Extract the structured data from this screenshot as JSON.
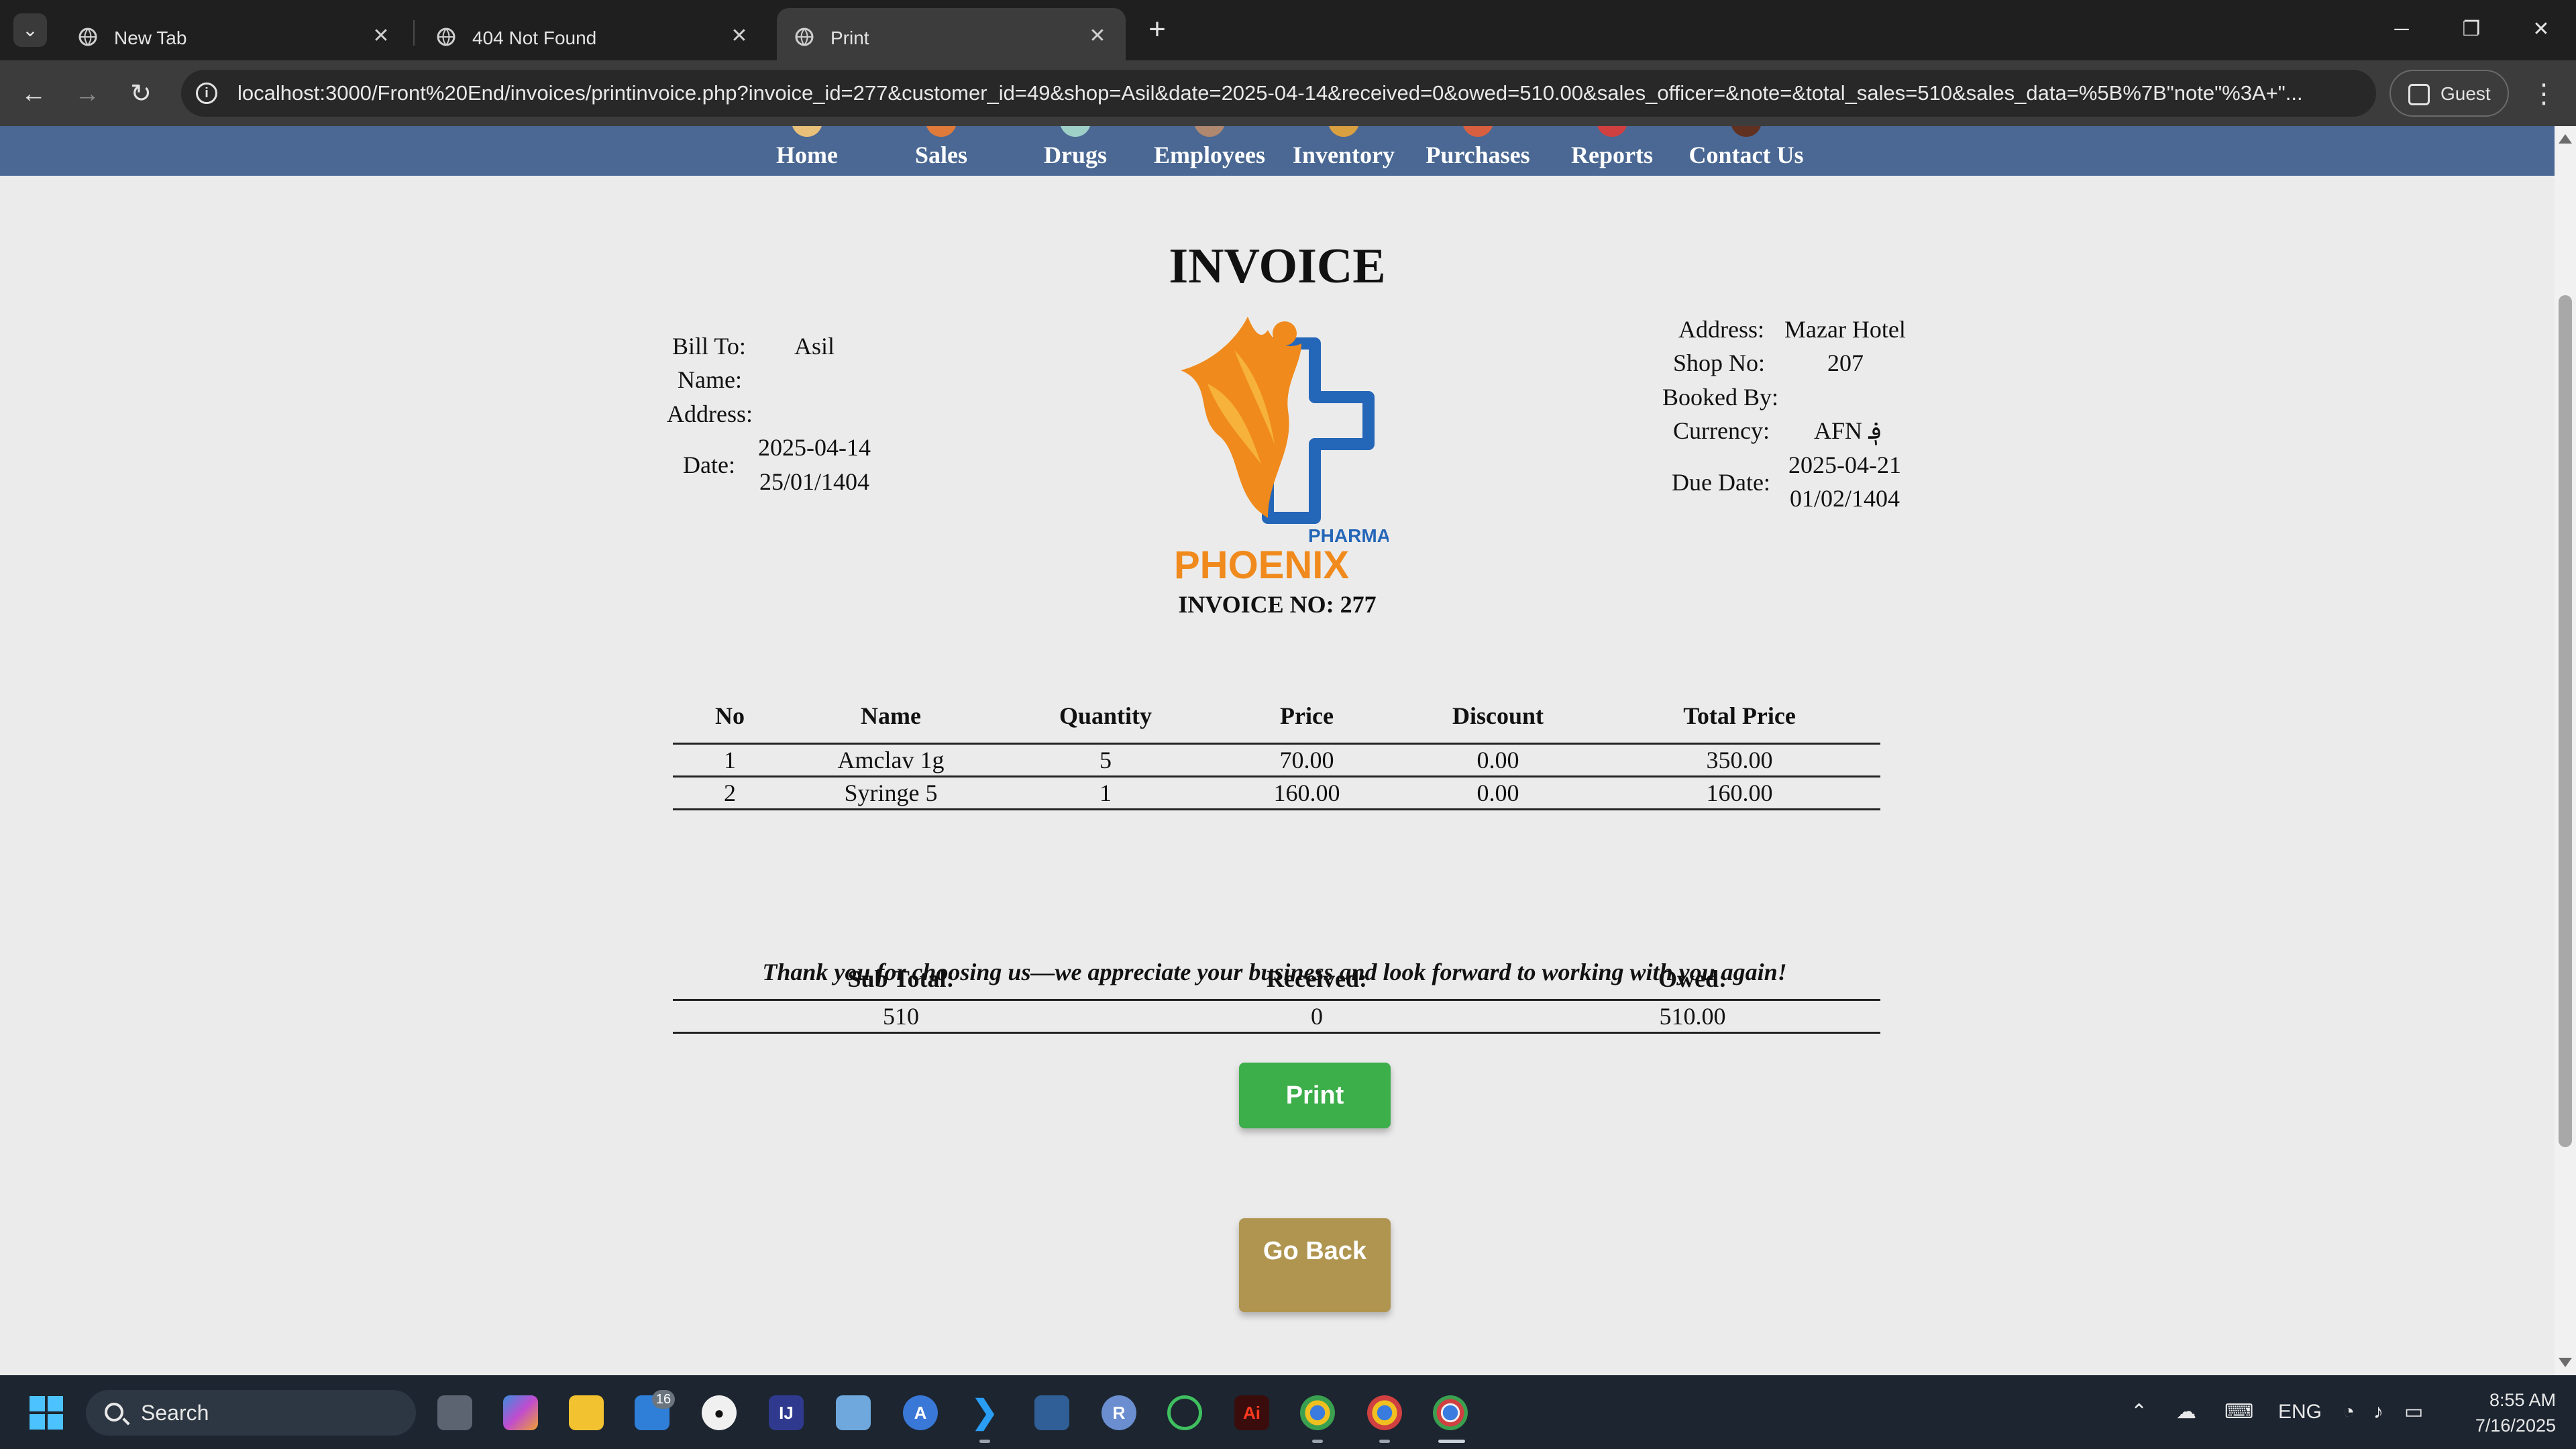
{
  "browser": {
    "tabs": [
      {
        "title": "New Tab",
        "active": false
      },
      {
        "title": "404 Not Found",
        "active": false
      },
      {
        "title": "Print",
        "active": true
      }
    ],
    "url": "localhost:3000/Front%20End/invoices/printinvoice.php?invoice_id=277&customer_id=49&shop=Asil&date=2025-04-14&received=0&owed=510.00&sales_officer=&note=&total_sales=510&sales_data=%5B%7B\"note\"%3A+\"...",
    "profile_label": "Guest"
  },
  "site_nav": {
    "items": [
      {
        "label": "Home",
        "icon": "home-icon",
        "color": "#e8c07a"
      },
      {
        "label": "Sales",
        "icon": "sales-icon",
        "color": "#e07a3a"
      },
      {
        "label": "Drugs",
        "icon": "drugs-icon",
        "color": "#9fd0c8"
      },
      {
        "label": "Employees",
        "icon": "employees-icon",
        "color": "#b08870"
      },
      {
        "label": "Inventory",
        "icon": "inventory-icon",
        "color": "#d9a040"
      },
      {
        "label": "Purchases",
        "icon": "purchases-icon",
        "color": "#d86040"
      },
      {
        "label": "Reports",
        "icon": "reports-icon",
        "color": "#d04040"
      },
      {
        "label": "Contact Us",
        "icon": "contact-icon",
        "color": "#603020"
      }
    ]
  },
  "invoice": {
    "title": "INVOICE",
    "bill_to_label": "Bill To:",
    "bill_to_value": "Asil",
    "name_label": "Name:",
    "address_label": "Address:",
    "date_label": "Date:",
    "date_gregorian": "2025-04-14",
    "date_solar": "25/01/1404",
    "right_address_label": "Address:",
    "right_address_value": "Mazar Hotel",
    "shop_no_label": "Shop No:",
    "shop_no_value": "207",
    "booked_by_label": "Booked By:",
    "currency_label": "Currency:",
    "currency_value": "AFN ؋",
    "due_date_label": "Due Date:",
    "due_date_gregorian": "2025-04-21",
    "due_date_solar": "01/02/1404",
    "logo_small": "PHARMA",
    "logo_big": "PHOENIX",
    "invoice_no": "INVOICE NO: 277",
    "columns": [
      "No",
      "Name",
      "Quantity",
      "Price",
      "Discount",
      "Total Price"
    ],
    "rows": [
      [
        "1",
        "Amclav 1g",
        "5",
        "70.00",
        "0.00",
        "350.00"
      ],
      [
        "2",
        "Syringe 5",
        "1",
        "160.00",
        "0.00",
        "160.00"
      ]
    ],
    "totals_headers": [
      "Sub Total:",
      "Received:",
      "Owed:"
    ],
    "totals_values": [
      "510",
      "0",
      "510.00"
    ],
    "thanks": "Thank you for choosing us—we appreciate your business and look forward to working with you again!",
    "print_button": "Print",
    "back_button": "Go Back"
  },
  "taskbar": {
    "search_label": "Search",
    "badge_count": "16",
    "language": "ENG",
    "time": "8:55 AM",
    "date": "7/16/2025"
  },
  "colors": {
    "nav_bg": "#4a6893",
    "print_btn": "#3cae4a",
    "back_btn": "#b09550",
    "logo_orange": "#f08a1c",
    "logo_blue": "#2466b8"
  }
}
